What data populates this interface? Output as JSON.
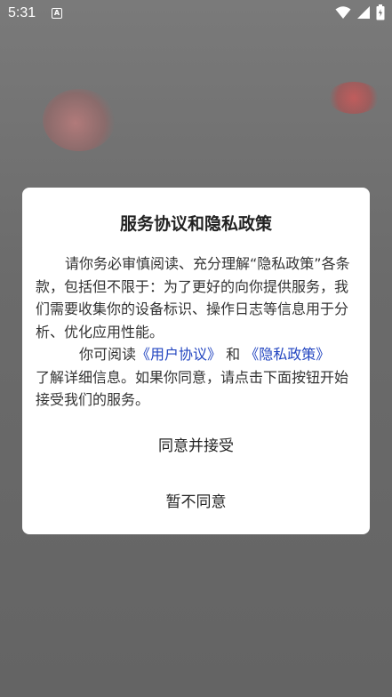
{
  "status_bar": {
    "time": "5:31",
    "app_icon": "A",
    "icons": [
      "wifi-icon",
      "signal-icon",
      "battery-icon"
    ]
  },
  "dialog": {
    "title": "服务协议和隐私政策",
    "paragraph1": "请你务必审慎阅读、充分理解“隐私政策”各条款，包括但不限于：为了更好的向你提供服务，我们需要收集你的设备标识、操作日志等信息用于分析、优化应用性能。",
    "read_prefix": "你可阅读",
    "user_agreement_link": "《用户协议》",
    "and_text": "和",
    "privacy_policy_link": "《隐私政策》",
    "paragraph2_tail": "了解详细信息。如果你同意，请点击下面按钮开始接受我们的服务。",
    "agree_button": "同意并接受",
    "disagree_button": "暂不同意"
  },
  "colors": {
    "link": "#2245c0",
    "overlay": "#6f6f6f",
    "dialog_bg": "#ffffff"
  }
}
